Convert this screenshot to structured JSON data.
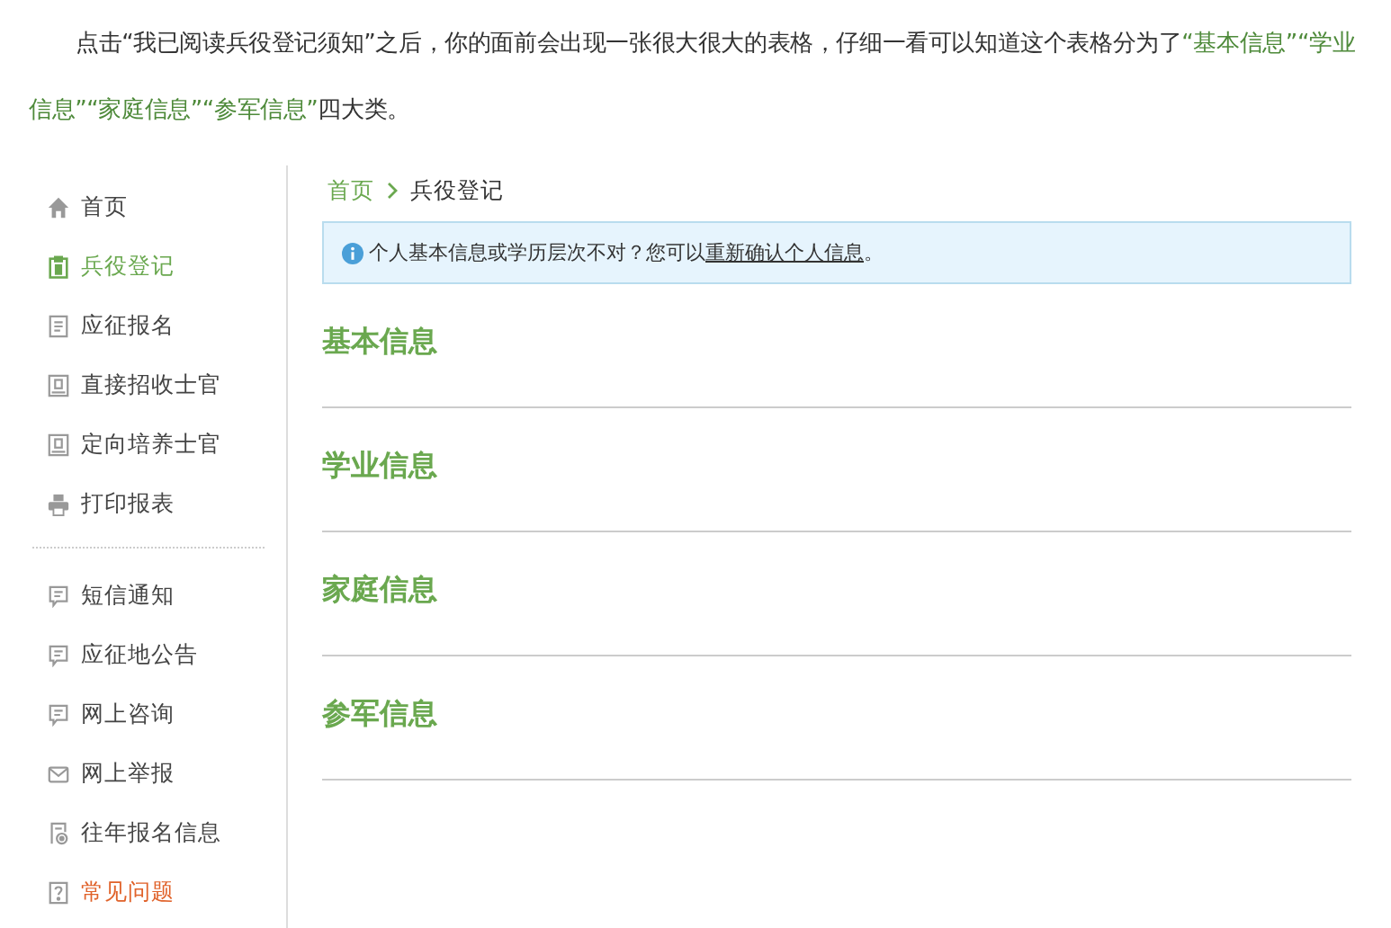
{
  "intro": [
    {
      "text": "点击“我已阅读兵役登记须知”之后，你的面前会出现一张很大很大的表格，仔细一看可以知道这个表格分为了",
      "highlight": false
    },
    {
      "text": "“基本信息”",
      "highlight": true
    },
    {
      "text": "“学业信息”",
      "highlight": true
    },
    {
      "text": "“家庭信息”",
      "highlight": true
    },
    {
      "text": "“参军信息”",
      "highlight": true
    },
    {
      "text": "四大类。",
      "highlight": false
    }
  ],
  "sidebar": {
    "groups": [
      {
        "items": [
          {
            "kind": "home",
            "label": "首页",
            "selected": false,
            "highlighted": false
          },
          {
            "kind": "clipboard",
            "label": "兵役登记",
            "selected": true,
            "highlighted": false
          },
          {
            "kind": "document",
            "label": "应征报名",
            "selected": false,
            "highlighted": false
          },
          {
            "kind": "badge",
            "label": "直接招收士官",
            "selected": false,
            "highlighted": false
          },
          {
            "kind": "badge",
            "label": "定向培养士官",
            "selected": false,
            "highlighted": false
          },
          {
            "kind": "printer",
            "label": "打印报表",
            "selected": false,
            "highlighted": false
          }
        ]
      },
      {
        "items": [
          {
            "kind": "chat",
            "label": "短信通知",
            "selected": false,
            "highlighted": false
          },
          {
            "kind": "chat",
            "label": "应征地公告",
            "selected": false,
            "highlighted": false
          },
          {
            "kind": "chat",
            "label": "网上咨询",
            "selected": false,
            "highlighted": false
          },
          {
            "kind": "mail",
            "label": "网上举报",
            "selected": false,
            "highlighted": false
          },
          {
            "kind": "archive",
            "label": "往年报名信息",
            "selected": false,
            "highlighted": false
          },
          {
            "kind": "help",
            "label": "常见问题",
            "selected": false,
            "highlighted": true
          }
        ]
      }
    ]
  },
  "breadcrumb": [
    "首页",
    "兵役登记"
  ],
  "notice": {
    "text": "个人基本信息或学历层次不对？您可以",
    "link": "重新确认个人信息",
    "end": "。"
  },
  "sections": [
    "基本信息",
    "学业信息",
    "家庭信息",
    "参军信息"
  ]
}
